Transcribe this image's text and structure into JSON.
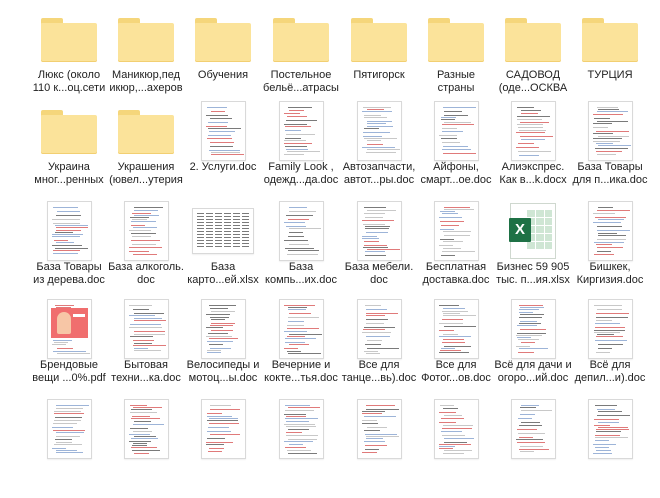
{
  "items": [
    {
      "kind": "folder",
      "lines": [
        "Люкс (около",
        "110 к...оц.сети"
      ]
    },
    {
      "kind": "folder",
      "lines": [
        "Маникюр,пед",
        "икюр,...ахеров"
      ]
    },
    {
      "kind": "folder",
      "lines": [
        "Обучения"
      ]
    },
    {
      "kind": "folder",
      "lines": [
        "Постельное",
        "бельё...атрасы"
      ]
    },
    {
      "kind": "folder",
      "lines": [
        "Пятигорск"
      ]
    },
    {
      "kind": "folder",
      "lines": [
        "Разные",
        "страны"
      ]
    },
    {
      "kind": "folder",
      "lines": [
        "САДОВОД",
        "(оде...ОСКВА"
      ]
    },
    {
      "kind": "folder",
      "lines": [
        "ТУРЦИЯ"
      ]
    },
    {
      "kind": "folder",
      "lines": [
        "Украина",
        "мног...ренных"
      ]
    },
    {
      "kind": "folder",
      "lines": [
        "Украшения",
        "(ювел...утерия"
      ]
    },
    {
      "kind": "doc",
      "lines": [
        "2. Услуги.doc"
      ]
    },
    {
      "kind": "doc",
      "lines": [
        "Family Look ,",
        "одежд...да.doc"
      ]
    },
    {
      "kind": "doc",
      "lines": [
        "Автозапчасти,",
        "автот...ры.doc"
      ]
    },
    {
      "kind": "doc",
      "lines": [
        "Айфоны,",
        "смарт...oe.doc"
      ]
    },
    {
      "kind": "doc",
      "lines": [
        "Алиэкспрес.",
        "Как в...k.docx"
      ]
    },
    {
      "kind": "doc",
      "lines": [
        "База Товары",
        "для п...ика.doc"
      ]
    },
    {
      "kind": "doc",
      "lines": [
        "База Товары",
        "из дерева.doc"
      ]
    },
    {
      "kind": "doc",
      "lines": [
        "База алкоголь.",
        "doc"
      ]
    },
    {
      "kind": "sheet",
      "lines": [
        "База",
        "карто...ей.xlsx"
      ]
    },
    {
      "kind": "doc",
      "lines": [
        "База",
        "компь...их.doc"
      ]
    },
    {
      "kind": "doc",
      "lines": [
        "База мебели.",
        "doc"
      ]
    },
    {
      "kind": "doc",
      "lines": [
        "Бесплатная",
        "доставка.doc"
      ]
    },
    {
      "kind": "xls",
      "lines": [
        "Бизнес 59 905",
        "тыс. п...ия.xlsx"
      ]
    },
    {
      "kind": "doc",
      "lines": [
        "Бишкек,",
        "Киргизия.doc"
      ]
    },
    {
      "kind": "pdf",
      "lines": [
        "Брендовые",
        "вещи ...0%.pdf"
      ]
    },
    {
      "kind": "doc",
      "lines": [
        "Бытовая",
        "техни...ка.doc"
      ]
    },
    {
      "kind": "doc",
      "lines": [
        "Велосипеды и",
        "мотоц...ы.doc"
      ]
    },
    {
      "kind": "doc",
      "lines": [
        "Вечерние и",
        "кокте...тья.doc"
      ]
    },
    {
      "kind": "doc",
      "lines": [
        "Все для",
        "танце...вь).doc"
      ]
    },
    {
      "kind": "doc",
      "lines": [
        "Все для",
        "Фотог...ов.doc"
      ]
    },
    {
      "kind": "doc",
      "lines": [
        "Всё для дачи и",
        "огоро...ий.doc"
      ]
    },
    {
      "kind": "doc",
      "lines": [
        "Всё для",
        "депил...и).doc"
      ]
    },
    {
      "kind": "doc",
      "lines": []
    },
    {
      "kind": "doc",
      "lines": []
    },
    {
      "kind": "doc",
      "lines": []
    },
    {
      "kind": "doc",
      "lines": []
    },
    {
      "kind": "doc",
      "lines": []
    },
    {
      "kind": "doc",
      "lines": []
    },
    {
      "kind": "doc",
      "lines": []
    },
    {
      "kind": "doc",
      "lines": []
    }
  ],
  "colors": {
    "folder": "#fbe39a",
    "excel": "#1e7145",
    "doc_line": "#9db4d8"
  }
}
